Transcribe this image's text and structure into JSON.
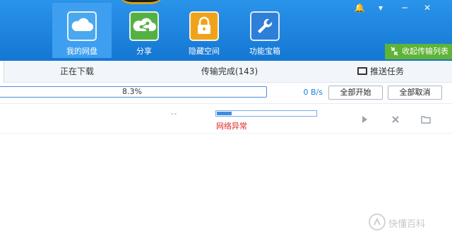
{
  "colors": {
    "brand_blue": "#1a86e4",
    "active_tab_blue": "#3e9ff0",
    "collapse_green": "#5fb336",
    "error_red": "#e0292a",
    "speed_blue": "#1a7fe0"
  },
  "header": {
    "nav": [
      {
        "label": "我的网盘",
        "icon": "cloud-icon",
        "active": true
      },
      {
        "label": "分享",
        "icon": "share-icon",
        "active": false
      },
      {
        "label": "隐藏空间",
        "icon": "lock-icon",
        "active": false
      },
      {
        "label": "功能宝箱",
        "icon": "wrench-icon",
        "active": false
      }
    ],
    "window_buttons": {
      "notify": "🔔",
      "menu": "▾",
      "minimize": "─",
      "close": "✕"
    },
    "collapse_label": "收起传输列表"
  },
  "tabs": [
    {
      "label": "正在下载"
    },
    {
      "label": "传输完成(143)"
    },
    {
      "label": "推送任务"
    }
  ],
  "progress": {
    "percent_text": "8.3%",
    "percent": 8.3,
    "speed": "0 B/s",
    "start_all": "全部开始",
    "cancel_all": "全部取消"
  },
  "task": {
    "size_text": "--",
    "progress_fraction": 0.15,
    "status": "网络异常"
  },
  "watermark": {
    "text": "快懂百科"
  }
}
